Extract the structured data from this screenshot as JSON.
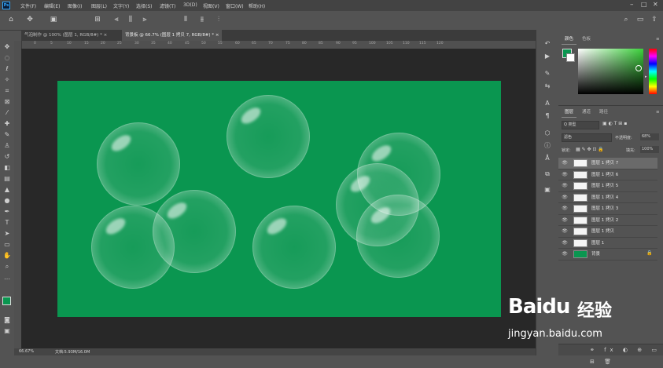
{
  "app": {
    "logo": "Ps"
  },
  "menubar": {
    "items": [
      "文件(F)",
      "编辑(E)",
      "图像(I)",
      "图层(L)",
      "文字(Y)",
      "选择(S)",
      "滤镜(T)",
      "3D(D)",
      "视图(V)",
      "窗口(W)",
      "帮助(H)"
    ]
  },
  "document_tabs": [
    {
      "label": "气泡制作 @ 100% (图层 1, RGB/8#) *"
    },
    {
      "label": "背景板 @ 66.7% (图层 1 拷贝 7, RGB/8#) *"
    }
  ],
  "ruler_top": {
    "ticks": [
      "0",
      "5",
      "10",
      "15",
      "20",
      "25",
      "30",
      "35",
      "40",
      "45",
      "50",
      "55",
      "60",
      "65",
      "70",
      "75",
      "80",
      "85",
      "90",
      "95",
      "100",
      "105",
      "110",
      "115",
      "120"
    ]
  },
  "color_panel": {
    "tabs": [
      "颜色",
      "色板"
    ],
    "accent": "#0a9650"
  },
  "layers_panel": {
    "tabs": [
      "图层",
      "通道",
      "路径"
    ],
    "filter_label": "Q 类型",
    "blend_mode": "滤色",
    "opacity_label": "不透明度:",
    "opacity_value": "68%",
    "lock_label": "锁定:",
    "fill_label": "填充:",
    "fill_value": "100%",
    "layers": [
      {
        "name": "图层 1 拷贝 7",
        "selected": true
      },
      {
        "name": "图层 1 拷贝 6"
      },
      {
        "name": "图层 1 拷贝 5"
      },
      {
        "name": "图层 1 拷贝 4"
      },
      {
        "name": "图层 1 拷贝 3"
      },
      {
        "name": "图层 1 拷贝 2"
      },
      {
        "name": "图层 1 拷贝"
      },
      {
        "name": "图层 1"
      },
      {
        "name": "背景",
        "background": true
      }
    ]
  },
  "status": {
    "zoom": "66.67%",
    "doc": "文档:5.93M/16.0M"
  },
  "watermark": {
    "brand": "Baidu",
    "cn": "经验",
    "url": "jingyan.baidu.com"
  }
}
